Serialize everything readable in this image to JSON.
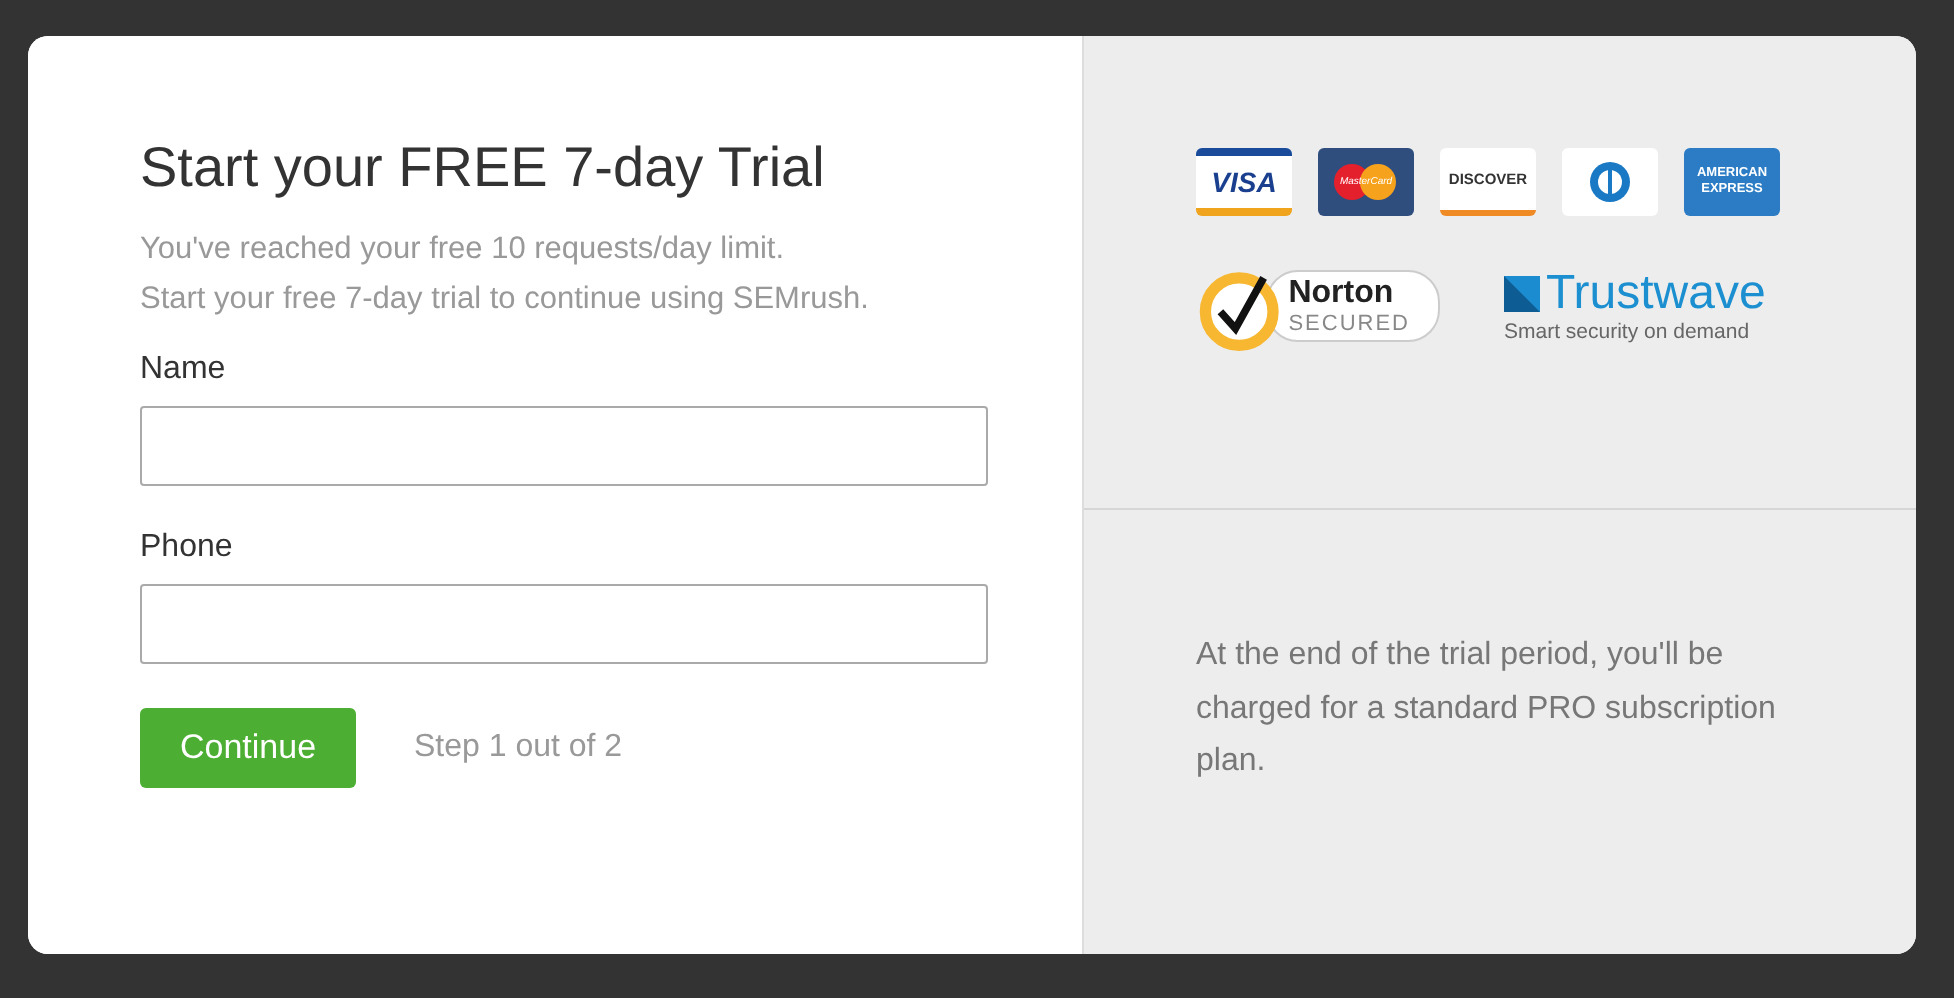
{
  "dialog": {
    "title": "Start your FREE 7-day Trial",
    "subtitle_lines": [
      "You've reached your free 10 requests/day limit.",
      "Start your free 7-day trial to continue using SEMrush."
    ],
    "fields": [
      {
        "label": "Name"
      },
      {
        "label": "Phone"
      }
    ],
    "button": "Continue",
    "step": "Step 1 out of 2"
  },
  "payment_cards": [
    {
      "kind": "visa",
      "text": "VISA"
    },
    {
      "kind": "mastercard",
      "text": "MasterCard"
    },
    {
      "kind": "discover",
      "text": "DISCOVER"
    },
    {
      "kind": "diners"
    },
    {
      "kind": "amex",
      "text": "AMERICAN EXPRESS"
    }
  ],
  "security_badges": [
    {
      "kind": "norton",
      "name": "Norton",
      "sub": "SECURED"
    },
    {
      "kind": "trustwave",
      "name": "Trustwave",
      "sub": "Smart security on demand"
    }
  ],
  "note": "At the end of the trial period, you'll be charged for a standard PRO subscription plan."
}
